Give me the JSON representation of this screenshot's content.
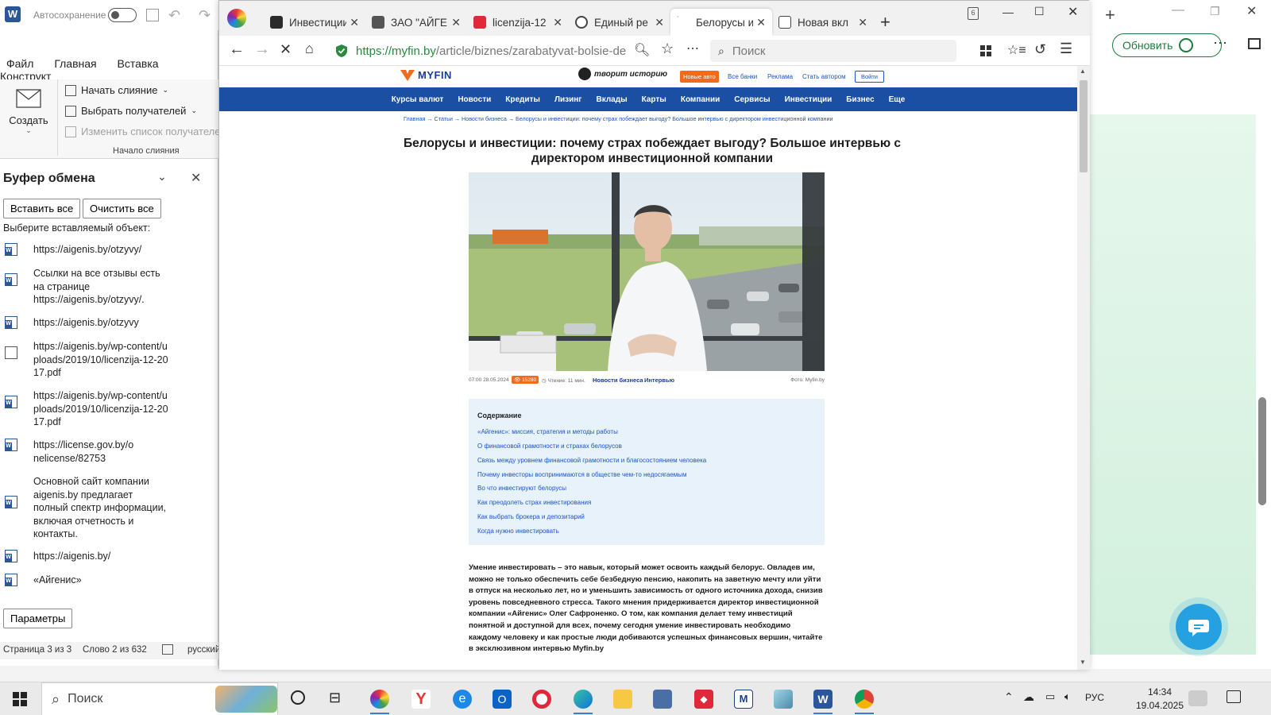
{
  "word": {
    "autosave_label": "Автосохранение",
    "tabs": [
      "Файл",
      "Главная",
      "Вставка",
      "Конструкт"
    ],
    "create_label": "Создать",
    "ribbon_items": [
      "Начать слияние",
      "Выбрать получателей",
      "Изменить список получателей"
    ],
    "group_label": "Начало слияния",
    "clipboard": {
      "title": "Буфер обмена",
      "paste_all": "Вставить все",
      "clear_all": "Очистить все",
      "prompt": "Выберите вставляемый объект:",
      "items": [
        "https://aigenis.by/otzyvy/",
        "Ссылки на все отзывы есть на странице https://aigenis.by/otzyvy/.",
        "https://aigenis.by/otzyvy",
        "https://aigenis.by/wp-content/uploads/2019/10/licenzija-12-2017.pdf",
        "https://aigenis.by/wp-content/uploads/2019/10/licenzija-12-2017.pdf",
        "https://license.gov.by/onelicense/82753",
        "Основной сайт компании aigenis.by предлагает полный спектр информации, включая отчетность и контакты.",
        "https://aigenis.by/",
        "«Айгенис»"
      ],
      "params": "Параметры"
    },
    "status": {
      "page": "Страница 3 из 3",
      "words": "Слово 2 из 632",
      "lang": "русский"
    }
  },
  "browser": {
    "tabs": [
      {
        "title": "Инвестиции",
        "color": "#2b2b2b"
      },
      {
        "title": "ЗАО \"АЙГЕ",
        "color": "#555555"
      },
      {
        "title": "licenzija-12",
        "color": "#e0283a"
      },
      {
        "title": "Единый ре",
        "color": "#444444"
      },
      {
        "title": "Белорусы и",
        "color": "#1b4fa3"
      },
      {
        "title": "Новая вкл",
        "color": "#444444"
      }
    ],
    "tab_count": "6",
    "url_main": "https://myfin.by",
    "url_rest": "/article/biznes/zarabatyvat-bolsie-de",
    "search_placeholder": "Поиск"
  },
  "site": {
    "logo": "MYFIN",
    "slogan": "творит историю",
    "badge": "Новые авто",
    "links": [
      "Все банки",
      "Реклама",
      "Стать автором"
    ],
    "login": "Войти",
    "nav": [
      "Курсы валют",
      "Новости",
      "Кредиты",
      "Лизинг",
      "Вклады",
      "Карты",
      "Компании",
      "Сервисы",
      "Инвестиции",
      "Бизнес",
      "Еще"
    ],
    "breadcrumbs": "Главная → Статьи → Новости бизнеса → Белорусы и инвестиции: почему страх побеждает выгоду? Большое интервью с директором инвестиционной компании",
    "title": "Белорусы и инвестиции: почему страх побеждает выгоду? Большое интервью с директором инвестиционной компании",
    "meta": {
      "date": "07:00 28.05.2024",
      "views": "15280",
      "read": "Чтение: 11 мин.",
      "tags": [
        "Новости бизнеса",
        "Интервью"
      ],
      "photo": "Фото: Myfin.by"
    },
    "toc_title": "Содержание",
    "toc": [
      "«Айгенис»: миссия, стратегия и методы работы",
      "О финансовой грамотности и страхах белорусов",
      "Связь между уровнем финансовой грамотности и благосостоянием человека",
      "Почему инвесторы воспринимаются в обществе чем-то недосягаемым",
      "Во что инвестируют белорусы",
      "Как преодолеть страх инвестирования",
      "Как выбрать брокера и депозитарий",
      "Когда нужно инвестировать"
    ],
    "lead": "Умение инвестировать – это навык, который может освоить каждый белорус. Овладев им, можно не только обеспечить себе безбедную пенсию, накопить на заветную мечту или уйти в отпуск на несколько лет, но и уменьшить зависимость от одного источника дохода, снизив уровень повседневного стресса. Такого мнения придерживается директор инвестиционной компании «Айгенис» Олег Сафроненко. О том, как компания делает тему инвестиций понятной и доступной для всех, почему сегодня умение инвестировать необходимо каждому человеку и как простые люди добиваются успешных финансовых вершин, читайте в эксклюзивном интервью Myfin.by"
  },
  "edge": {
    "update_label": "Обновить"
  },
  "taskbar": {
    "search": "Поиск",
    "lang": "РУС",
    "time": "14:34",
    "date": "19.04.2025"
  },
  "colors": {
    "myfin_blue": "#1b4fa3",
    "link_blue": "#1a56c4",
    "badge_orange": "#f26a1b",
    "toc_bg": "#e8f2fb",
    "url_green": "#2b8a3e"
  }
}
